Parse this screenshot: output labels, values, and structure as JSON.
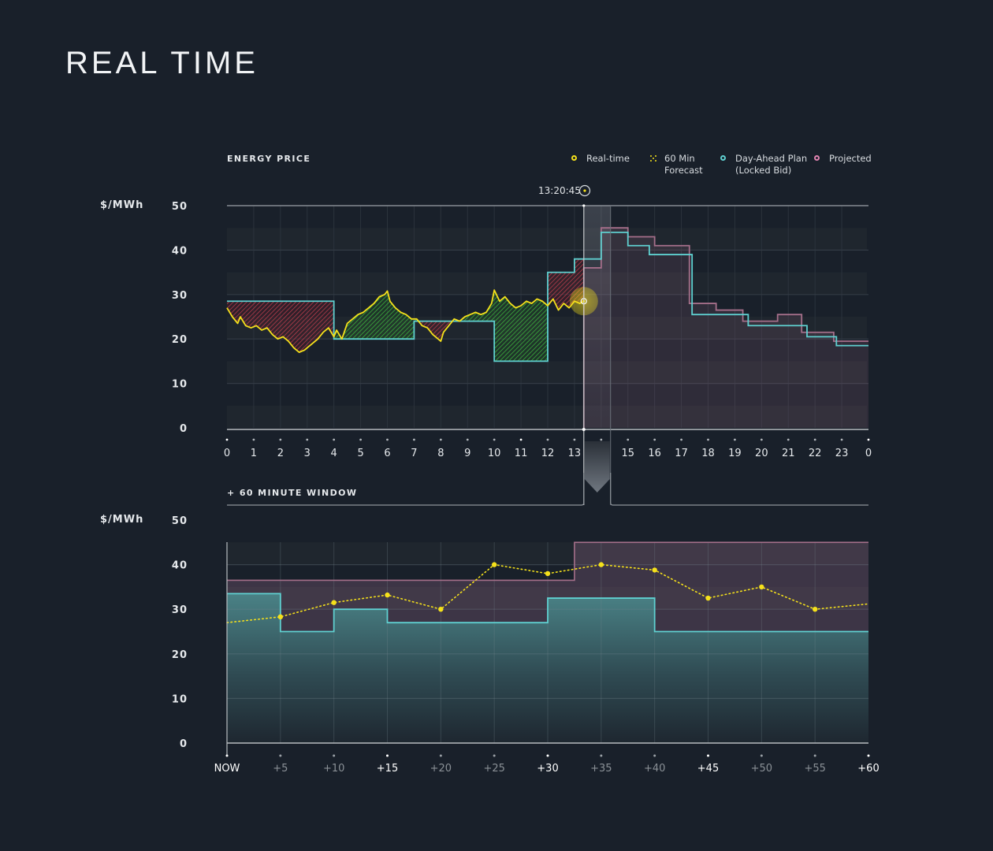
{
  "page": {
    "title": "REAL TIME"
  },
  "legend": [
    {
      "label": "Real-time",
      "color": "#f5e11b",
      "kind": "ring"
    },
    {
      "label": "60 Min\nForecast",
      "color": "#f5e11b",
      "kind": "dots"
    },
    {
      "label": "Day-Ahead Plan\n(Locked Bid)",
      "color": "#5fd0d0",
      "kind": "ring"
    },
    {
      "label": "Projected",
      "color": "#e083b0",
      "kind": "ring"
    }
  ],
  "colors": {
    "background": "#19202a",
    "realtime": "#f5e11b",
    "dayahead": "#5fd0d0",
    "projected": "#c98aa6",
    "savings": "#3fbf3f",
    "loss": "#d9485f",
    "grid": "#2e3640"
  },
  "current_time": {
    "label": "13:20:45",
    "hour": 13.35,
    "value": 28.5
  },
  "window_label": "+ 60 MINUTE WINDOW",
  "chart_data": [
    {
      "type": "line",
      "title": "ENERGY PRICE",
      "ylabel": "$/MWh",
      "xlabel": "",
      "ylim": [
        0,
        50
      ],
      "yticks": [
        "0",
        "10",
        "20",
        "30",
        "40",
        "50"
      ],
      "xlim": [
        0,
        24
      ],
      "xtick_labels": [
        "0",
        "1",
        "2",
        "3",
        "4",
        "5",
        "6",
        "7",
        "8",
        "9",
        "10",
        "11",
        "12",
        "13",
        "14",
        "15",
        "16",
        "17",
        "18",
        "19",
        "20",
        "21",
        "22",
        "23",
        "0"
      ],
      "grid": true,
      "legend_position": "top-right",
      "series": [
        {
          "name": "Real-time",
          "kind": "line",
          "x": [
            0,
            0.2,
            0.4,
            0.5,
            0.7,
            0.9,
            1.1,
            1.3,
            1.5,
            1.7,
            1.9,
            2.1,
            2.3,
            2.5,
            2.7,
            2.9,
            3.0,
            3.2,
            3.4,
            3.6,
            3.8,
            4.0,
            4.1,
            4.3,
            4.5,
            4.7,
            4.9,
            5.1,
            5.3,
            5.5,
            5.7,
            5.9,
            6.0,
            6.1,
            6.3,
            6.5,
            6.7,
            6.9,
            7.1,
            7.3,
            7.5,
            7.7,
            7.9,
            8.0,
            8.1,
            8.3,
            8.5,
            8.7,
            8.9,
            9.1,
            9.3,
            9.5,
            9.7,
            9.9,
            10.0,
            10.2,
            10.4,
            10.6,
            10.8,
            11.0,
            11.2,
            11.4,
            11.6,
            11.8,
            12.0,
            12.2,
            12.4,
            12.6,
            12.8,
            13.0,
            13.2,
            13.35
          ],
          "y": [
            27,
            25,
            23.5,
            25,
            23,
            22.5,
            23,
            22,
            22.5,
            21,
            20,
            20.5,
            19.5,
            18,
            17,
            17.5,
            18,
            19,
            20,
            21.5,
            22.5,
            20.5,
            22,
            20,
            23.5,
            24.5,
            25.5,
            26,
            27,
            28,
            29.5,
            30,
            30.8,
            28.5,
            27,
            26,
            25.5,
            24.5,
            24.5,
            23,
            22.5,
            21,
            20,
            19.5,
            21.5,
            23,
            24.5,
            24,
            25,
            25.5,
            26,
            25.5,
            26,
            28,
            31,
            28.5,
            29.5,
            28,
            27,
            27.5,
            28.5,
            28,
            29,
            28.5,
            27.5,
            29,
            26.5,
            28,
            27,
            28.5,
            28,
            28.5
          ]
        },
        {
          "name": "Day-Ahead Plan (Locked Bid)",
          "kind": "step",
          "steps": [
            {
              "from": 0,
              "to": 4,
              "value": 28.5
            },
            {
              "from": 4,
              "to": 7,
              "value": 20
            },
            {
              "from": 7,
              "to": 10,
              "value": 24
            },
            {
              "from": 10,
              "to": 12,
              "value": 15
            },
            {
              "from": 12,
              "to": 13,
              "value": 35
            },
            {
              "from": 13,
              "to": 14,
              "value": 38
            },
            {
              "from": 14,
              "to": 15,
              "value": 44
            },
            {
              "from": 15,
              "to": 15.8,
              "value": 41
            },
            {
              "from": 15.8,
              "to": 17.4,
              "value": 39
            },
            {
              "from": 17.4,
              "to": 19.5,
              "value": 25.5
            },
            {
              "from": 19.5,
              "to": 21.7,
              "value": 23
            },
            {
              "from": 21.7,
              "to": 22.8,
              "value": 20.5
            },
            {
              "from": 22.8,
              "to": 24,
              "value": 18.5
            }
          ]
        },
        {
          "name": "Projected",
          "kind": "step",
          "steps": [
            {
              "from": 13.35,
              "to": 14,
              "value": 36
            },
            {
              "from": 14,
              "to": 15,
              "value": 45
            },
            {
              "from": 15,
              "to": 16,
              "value": 43
            },
            {
              "from": 16,
              "to": 17.3,
              "value": 41
            },
            {
              "from": 17.3,
              "to": 18.3,
              "value": 28
            },
            {
              "from": 18.3,
              "to": 19.3,
              "value": 26.5
            },
            {
              "from": 19.3,
              "to": 20.6,
              "value": 24
            },
            {
              "from": 20.6,
              "to": 21.5,
              "value": 25.5
            },
            {
              "from": 21.5,
              "to": 22.7,
              "value": 21.5
            },
            {
              "from": 22.7,
              "to": 24,
              "value": 19.5
            }
          ]
        }
      ]
    },
    {
      "type": "line",
      "title": "+ 60 MINUTE WINDOW",
      "ylabel": "$/MWh",
      "ylim": [
        0,
        50
      ],
      "yticks": [
        "0",
        "10",
        "20",
        "30",
        "40",
        "50"
      ],
      "xlim": [
        0,
        60
      ],
      "xtick_labels": [
        "NOW",
        "+5",
        "+10",
        "+15",
        "+20",
        "+25",
        "+30",
        "+35",
        "+40",
        "+45",
        "+50",
        "+55",
        "+60"
      ],
      "xtick_emphasis": [
        true,
        false,
        false,
        true,
        false,
        false,
        true,
        false,
        false,
        true,
        false,
        false,
        true
      ],
      "grid": true,
      "series": [
        {
          "name": "60 Min Forecast",
          "kind": "dotted",
          "x": [
            0,
            5,
            10,
            15,
            20,
            25,
            30,
            35,
            40,
            45,
            50,
            55,
            60
          ],
          "y": [
            27,
            28.3,
            31.5,
            33.2,
            30,
            40,
            38,
            40,
            38.8,
            32.5,
            35,
            30,
            31.2
          ],
          "markers_at": [
            5,
            10,
            15,
            20,
            25,
            30,
            35,
            40,
            45,
            50,
            55
          ]
        },
        {
          "name": "Day-Ahead Plan (Locked Bid)",
          "kind": "step",
          "steps": [
            {
              "from": 0,
              "to": 5,
              "value": 33.5
            },
            {
              "from": 5,
              "to": 10,
              "value": 25
            },
            {
              "from": 10,
              "to": 15,
              "value": 30
            },
            {
              "from": 15,
              "to": 30,
              "value": 27
            },
            {
              "from": 30,
              "to": 40,
              "value": 32.5
            },
            {
              "from": 40,
              "to": 60,
              "value": 25
            }
          ]
        },
        {
          "name": "Projected",
          "kind": "step",
          "steps": [
            {
              "from": 0,
              "to": 32.5,
              "value": 36.5
            },
            {
              "from": 32.5,
              "to": 60,
              "value": 45
            }
          ]
        }
      ]
    }
  ]
}
